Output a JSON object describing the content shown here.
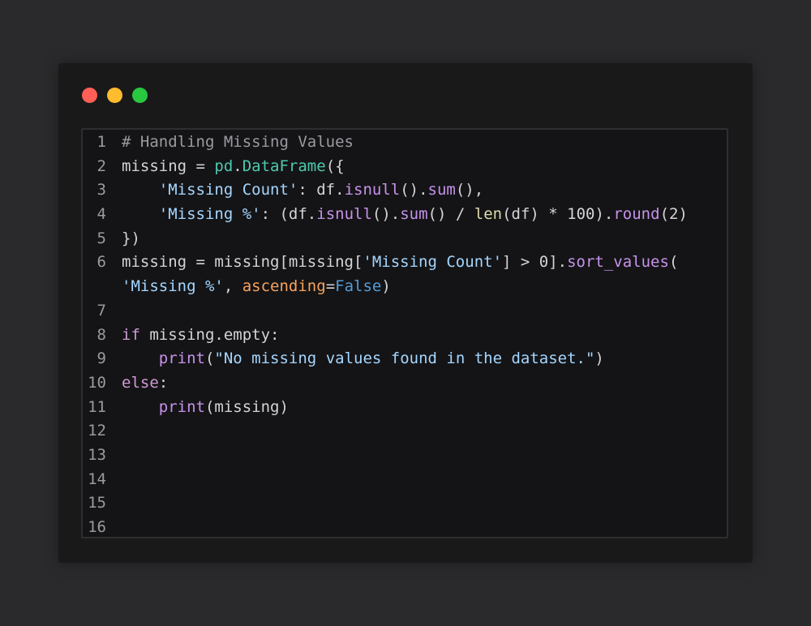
{
  "window": {
    "traffic_lights": [
      {
        "name": "close",
        "color": "#ff5f57"
      },
      {
        "name": "minimize",
        "color": "#febc2e"
      },
      {
        "name": "maximize",
        "color": "#28c840"
      }
    ]
  },
  "colors": {
    "comment": "#9a9aa0",
    "text": "#d4d4d8",
    "module": "#4ec9b0",
    "function": "#c792ea",
    "string": "#a5d6ff",
    "keyword": "#d19ad6",
    "param": "#f7a35c",
    "constant": "#569cd6",
    "builtin": "#dcdcaa"
  },
  "lines": [
    {
      "n": "1",
      "tokens": [
        {
          "t": "# Handling Missing Values",
          "k": "comment"
        }
      ]
    },
    {
      "n": "2",
      "tokens": [
        {
          "t": "missing = ",
          "k": "text"
        },
        {
          "t": "pd",
          "k": "module"
        },
        {
          "t": ".",
          "k": "text"
        },
        {
          "t": "DataFrame",
          "k": "module"
        },
        {
          "t": "({",
          "k": "text"
        }
      ]
    },
    {
      "n": "3",
      "tokens": [
        {
          "t": "    ",
          "k": "text"
        },
        {
          "t": "'Missing Count'",
          "k": "string"
        },
        {
          "t": ": df.",
          "k": "text"
        },
        {
          "t": "isnull",
          "k": "function"
        },
        {
          "t": "().",
          "k": "text"
        },
        {
          "t": "sum",
          "k": "function"
        },
        {
          "t": "(),",
          "k": "text"
        }
      ]
    },
    {
      "n": "4",
      "tokens": [
        {
          "t": "    ",
          "k": "text"
        },
        {
          "t": "'Missing %'",
          "k": "string"
        },
        {
          "t": ": (df.",
          "k": "text"
        },
        {
          "t": "isnull",
          "k": "function"
        },
        {
          "t": "().",
          "k": "text"
        },
        {
          "t": "sum",
          "k": "function"
        },
        {
          "t": "() / ",
          "k": "text"
        },
        {
          "t": "len",
          "k": "builtin"
        },
        {
          "t": "(df) * 100).",
          "k": "text"
        },
        {
          "t": "round",
          "k": "function"
        },
        {
          "t": "(2)",
          "k": "text"
        }
      ]
    },
    {
      "n": "5",
      "tokens": [
        {
          "t": "})",
          "k": "text"
        }
      ]
    },
    {
      "n": "6",
      "tokens": [
        {
          "t": "missing = missing[missing[",
          "k": "text"
        },
        {
          "t": "'Missing Count'",
          "k": "string"
        },
        {
          "t": "] > 0].",
          "k": "text"
        },
        {
          "t": "sort_values",
          "k": "function"
        },
        {
          "t": "(",
          "k": "text"
        }
      ]
    },
    {
      "n": "",
      "tokens": [
        {
          "t": "'Missing %'",
          "k": "string"
        },
        {
          "t": ", ",
          "k": "text"
        },
        {
          "t": "ascending",
          "k": "param"
        },
        {
          "t": "=",
          "k": "text"
        },
        {
          "t": "False",
          "k": "constant"
        },
        {
          "t": ")",
          "k": "text"
        }
      ]
    },
    {
      "n": "7",
      "tokens": []
    },
    {
      "n": "8",
      "tokens": [
        {
          "t": "if",
          "k": "keyword"
        },
        {
          "t": " missing.empty:",
          "k": "text"
        }
      ]
    },
    {
      "n": "9",
      "tokens": [
        {
          "t": "    ",
          "k": "text"
        },
        {
          "t": "print",
          "k": "function"
        },
        {
          "t": "(",
          "k": "text"
        },
        {
          "t": "\"No missing values found in the dataset.\"",
          "k": "string"
        },
        {
          "t": ")",
          "k": "text"
        }
      ]
    },
    {
      "n": "10",
      "tokens": [
        {
          "t": "else",
          "k": "keyword"
        },
        {
          "t": ":",
          "k": "text"
        }
      ]
    },
    {
      "n": "11",
      "tokens": [
        {
          "t": "    ",
          "k": "text"
        },
        {
          "t": "print",
          "k": "function"
        },
        {
          "t": "(missing)",
          "k": "text"
        }
      ]
    },
    {
      "n": "12",
      "tokens": []
    },
    {
      "n": "13",
      "tokens": []
    },
    {
      "n": "14",
      "tokens": []
    },
    {
      "n": "15",
      "tokens": []
    },
    {
      "n": "16",
      "tokens": []
    }
  ]
}
